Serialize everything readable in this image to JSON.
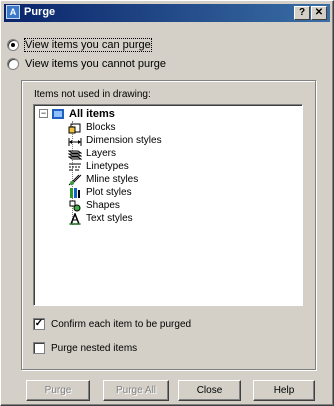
{
  "window": {
    "title": "Purge",
    "help_label": "?",
    "close_label": "✕"
  },
  "options": {
    "view_can_purge": "View items you can purge",
    "view_cannot_purge": "View items you cannot purge",
    "selected": "view_can_purge"
  },
  "tree": {
    "group_label": "Items not used in drawing:",
    "root": "All items",
    "expander": "−",
    "items": [
      {
        "label": "Blocks",
        "icon": "blocks-icon"
      },
      {
        "label": "Dimension styles",
        "icon": "dimension-styles-icon"
      },
      {
        "label": "Layers",
        "icon": "layers-icon"
      },
      {
        "label": "Linetypes",
        "icon": "linetypes-icon"
      },
      {
        "label": "Mline styles",
        "icon": "mline-styles-icon"
      },
      {
        "label": "Plot styles",
        "icon": "plot-styles-icon"
      },
      {
        "label": "Shapes",
        "icon": "shapes-icon"
      },
      {
        "label": "Text styles",
        "icon": "text-styles-icon"
      }
    ]
  },
  "checks": {
    "confirm_label": "Confirm each item to be purged",
    "confirm_checked": true,
    "nested_label": "Purge nested items",
    "nested_checked": false
  },
  "buttons": {
    "purge": "Purge",
    "purge_all": "Purge All",
    "close": "Close",
    "help": "Help"
  }
}
